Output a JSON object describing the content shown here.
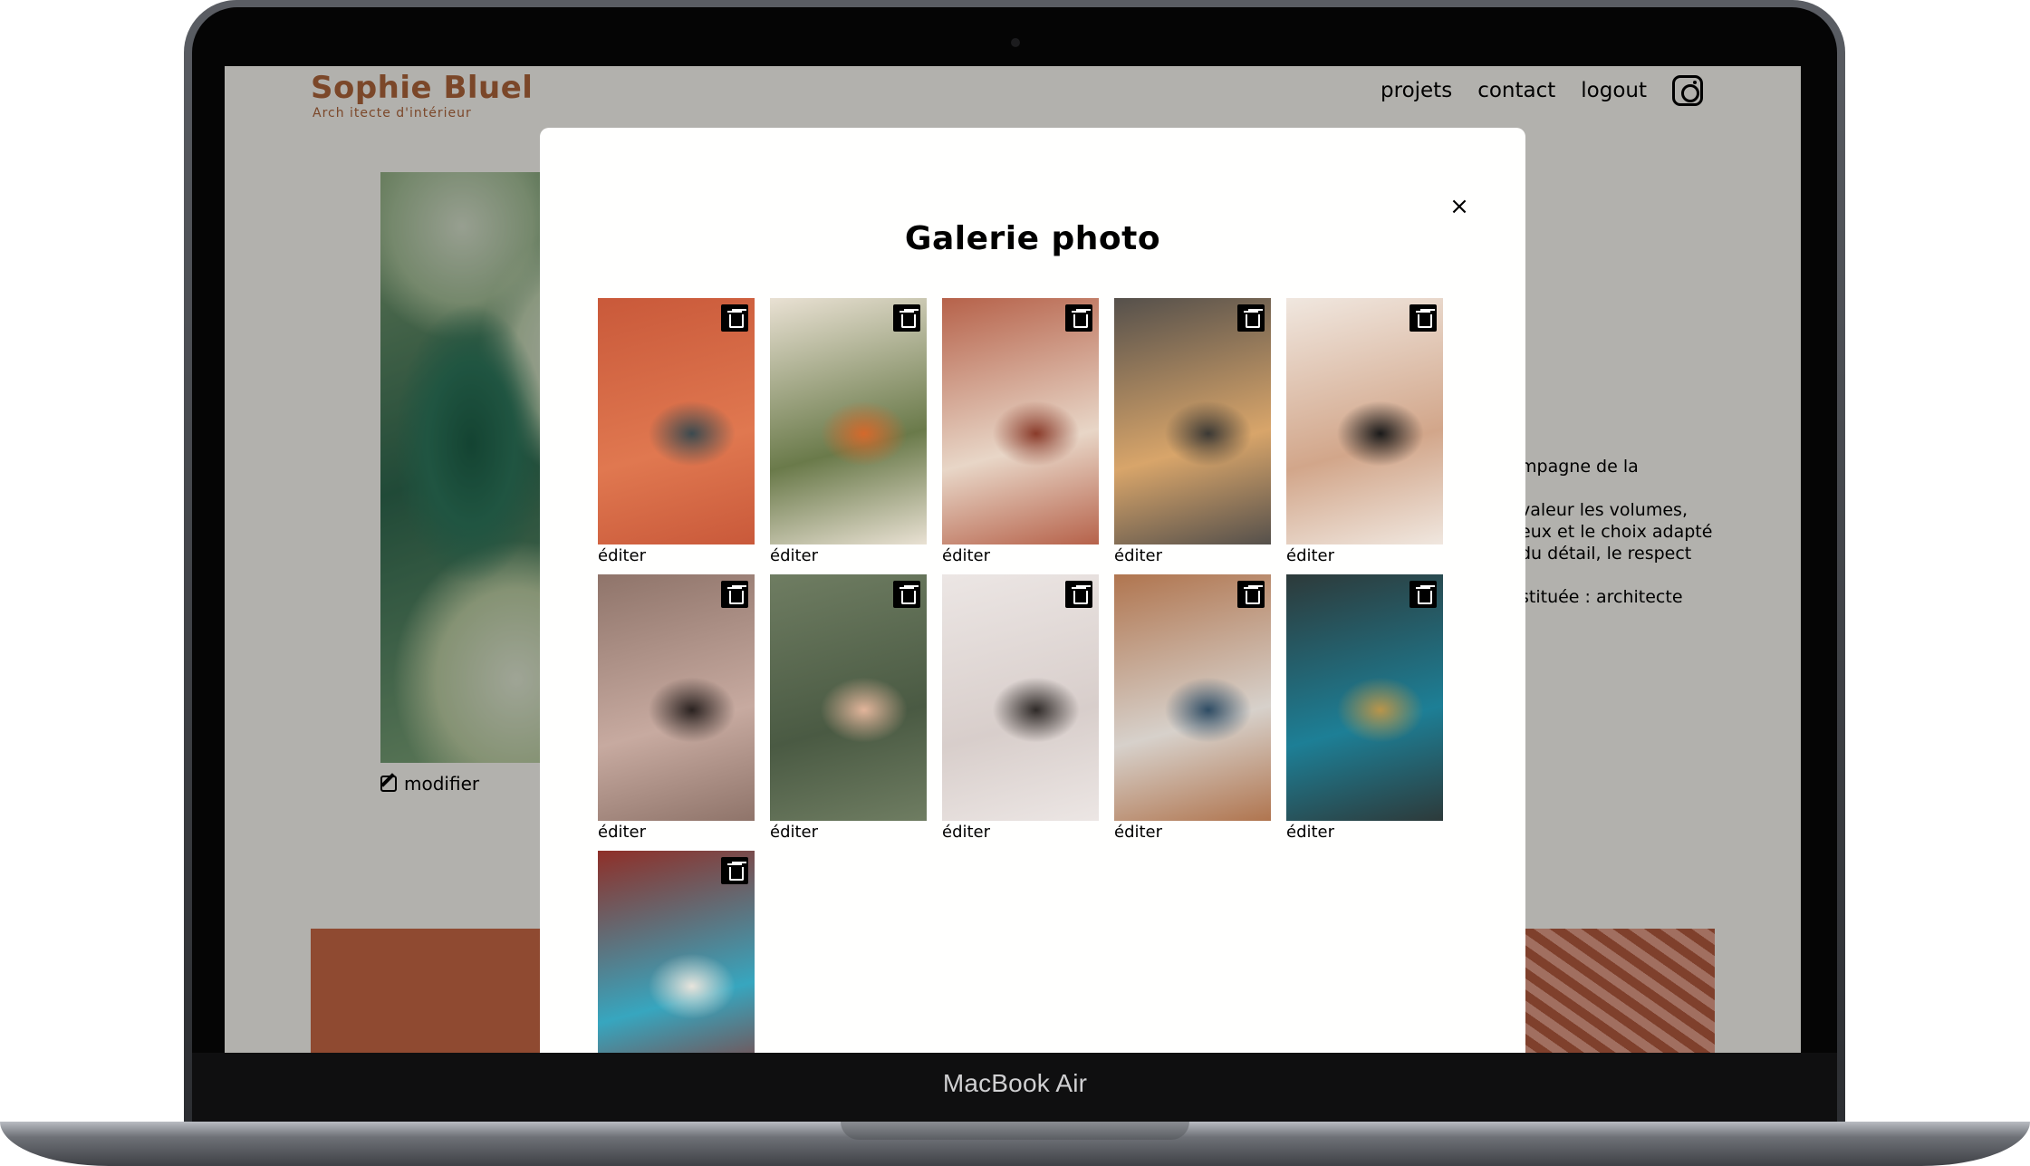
{
  "device": {
    "label": "MacBook Air"
  },
  "site": {
    "logo_title": "Sophie Bluel",
    "logo_subtitle": "Arch itecte d'intérieur",
    "nav": [
      {
        "label": "projets"
      },
      {
        "label": "contact"
      },
      {
        "label": "logout"
      }
    ],
    "instagram_icon": "instagram-icon",
    "modifier_label": "modifier",
    "intro_visible_text": "mpagne de la\n\n valeur les volumes,\neux et le choix adapté\n du détail, le respect\n\nstituée : architecte"
  },
  "modal": {
    "title": "Galerie photo",
    "close_label": "×",
    "edit_label": "éditer",
    "items": [
      {
        "colors": [
          "#c9593a",
          "#e07850",
          "#3b4a4f"
        ]
      },
      {
        "colors": [
          "#e9e1d3",
          "#6a7a4a",
          "#d4692c"
        ]
      },
      {
        "colors": [
          "#b6624a",
          "#e8d6c7",
          "#8a3b2a"
        ]
      },
      {
        "colors": [
          "#55504b",
          "#d8a56a",
          "#3b3935"
        ]
      },
      {
        "colors": [
          "#f0e7df",
          "#d2a68a",
          "#1a1a1a"
        ]
      },
      {
        "colors": [
          "#8f746a",
          "#c7aaa0",
          "#2a2220"
        ]
      },
      {
        "colors": [
          "#6f7d62",
          "#4a5a43",
          "#e2b59b"
        ]
      },
      {
        "colors": [
          "#ece6e4",
          "#d8cecb",
          "#2f2a28"
        ]
      },
      {
        "colors": [
          "#b0754f",
          "#d7d1cb",
          "#2e4c64"
        ]
      },
      {
        "colors": [
          "#2d3a3a",
          "#1d7f96",
          "#b9954a"
        ]
      },
      {
        "colors": [
          "#8f2f28",
          "#37a6bf",
          "#e8e4dc"
        ]
      }
    ]
  }
}
